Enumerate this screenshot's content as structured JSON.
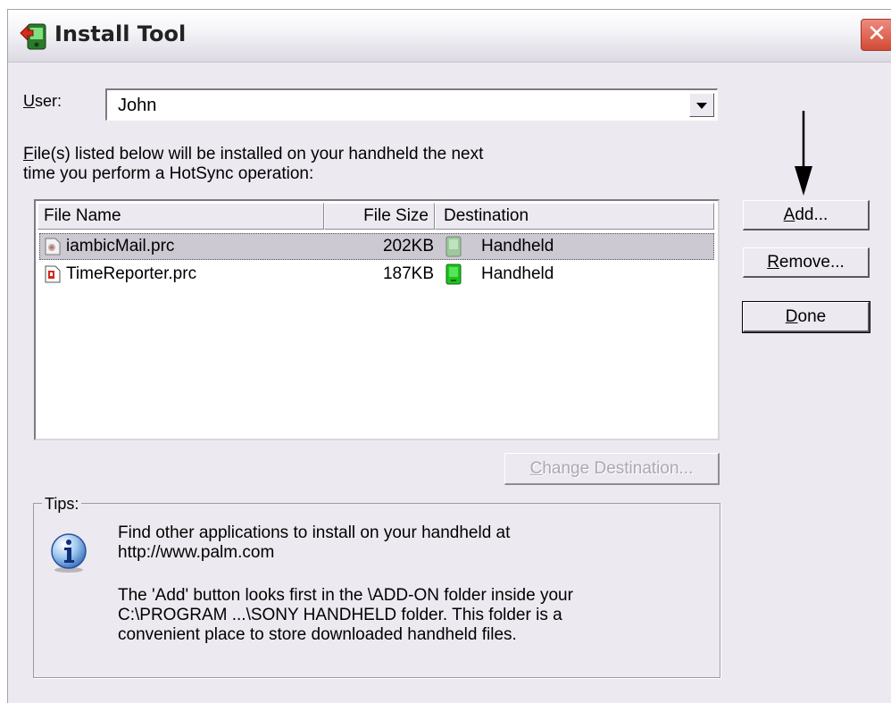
{
  "window": {
    "title": "Install Tool",
    "close_label": "✕"
  },
  "user": {
    "label_accel": "U",
    "label_rest": "ser:",
    "value": "John"
  },
  "instructions": {
    "line1_accel": "F",
    "line1_rest": "ile(s) listed below will be installed on your handheld the next",
    "line2": "time you perform a HotSync operation:"
  },
  "file_list": {
    "columns": [
      "File Name",
      "File Size",
      "Destination"
    ],
    "rows": [
      {
        "name": "iambicMail.prc",
        "size": "202KB",
        "destination": "Handheld",
        "selected": true
      },
      {
        "name": "TimeReporter.prc",
        "size": "187KB",
        "destination": "Handheld",
        "selected": false
      }
    ]
  },
  "buttons": {
    "add_accel": "A",
    "add_rest": "dd...",
    "remove_accel": "R",
    "remove_rest": "emove...",
    "done_accel": "D",
    "done_rest": "one",
    "change_accel": "C",
    "change_rest": "hange Destination..."
  },
  "tips": {
    "label": "Tips:",
    "line1": "Find other applications to install on your handheld at",
    "line2": "http://www.palm.com",
    "line3": "The 'Add' button looks first in the \\ADD-ON folder inside your",
    "line4": "C:\\PROGRAM ...\\SONY HANDHELD folder. This folder is a",
    "line5": "convenient place to store downloaded handheld files."
  },
  "icons": {
    "title": "palm-install-icon",
    "info": "info-icon",
    "file": "prc-file-icon",
    "destination": "handheld-icon"
  },
  "colors": {
    "window_bg": "#ece9f0",
    "close_button": "#d24a35",
    "selection": "#ccc9d2",
    "handheld_green": "#1ec21e"
  }
}
